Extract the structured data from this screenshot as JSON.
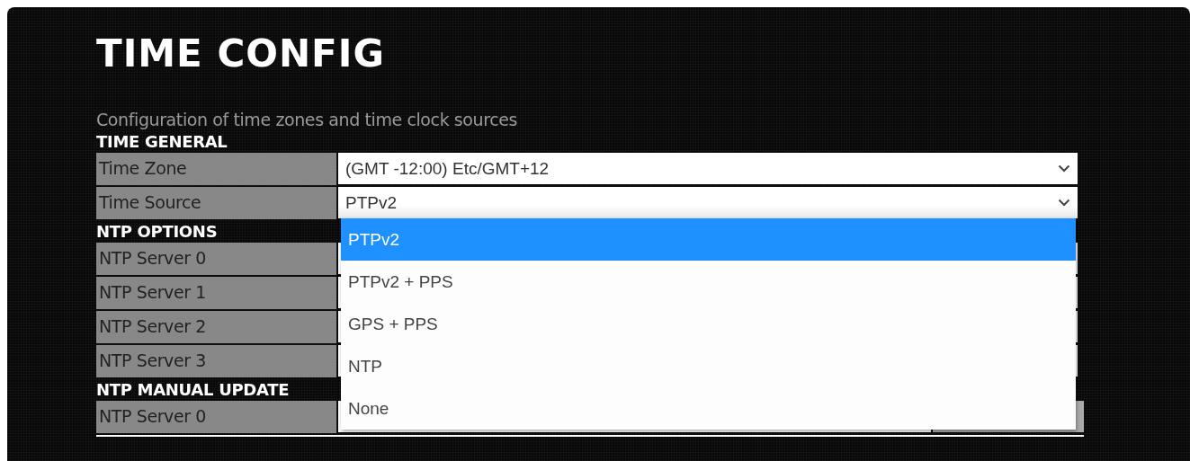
{
  "page": {
    "title": "TIME CONFIG",
    "description": "Configuration of time zones and time clock sources"
  },
  "sections": [
    {
      "heading": "TIME GENERAL",
      "rows": [
        {
          "label": "Time Zone",
          "kind": "select",
          "value": "(GMT -12:00) Etc/GMT+12"
        },
        {
          "label": "Time Source",
          "kind": "select",
          "value": "PTPv2",
          "open": true,
          "options": [
            {
              "label": "PTPv2",
              "selected": true
            },
            {
              "label": "PTPv2 + PPS",
              "selected": false
            },
            {
              "label": "GPS + PPS",
              "selected": false
            },
            {
              "label": "NTP",
              "selected": false
            },
            {
              "label": "None",
              "selected": false
            }
          ]
        }
      ]
    },
    {
      "heading": "NTP OPTIONS",
      "rows": [
        {
          "label": "NTP Server 0",
          "kind": "text"
        },
        {
          "label": "NTP Server 1",
          "kind": "text"
        },
        {
          "label": "NTP Server 2",
          "kind": "text"
        },
        {
          "label": "NTP Server 3",
          "kind": "text"
        }
      ]
    },
    {
      "heading": "NTP MANUAL UPDATE",
      "rows": [
        {
          "label": "NTP Server 0",
          "kind": "text-button"
        }
      ]
    }
  ]
}
